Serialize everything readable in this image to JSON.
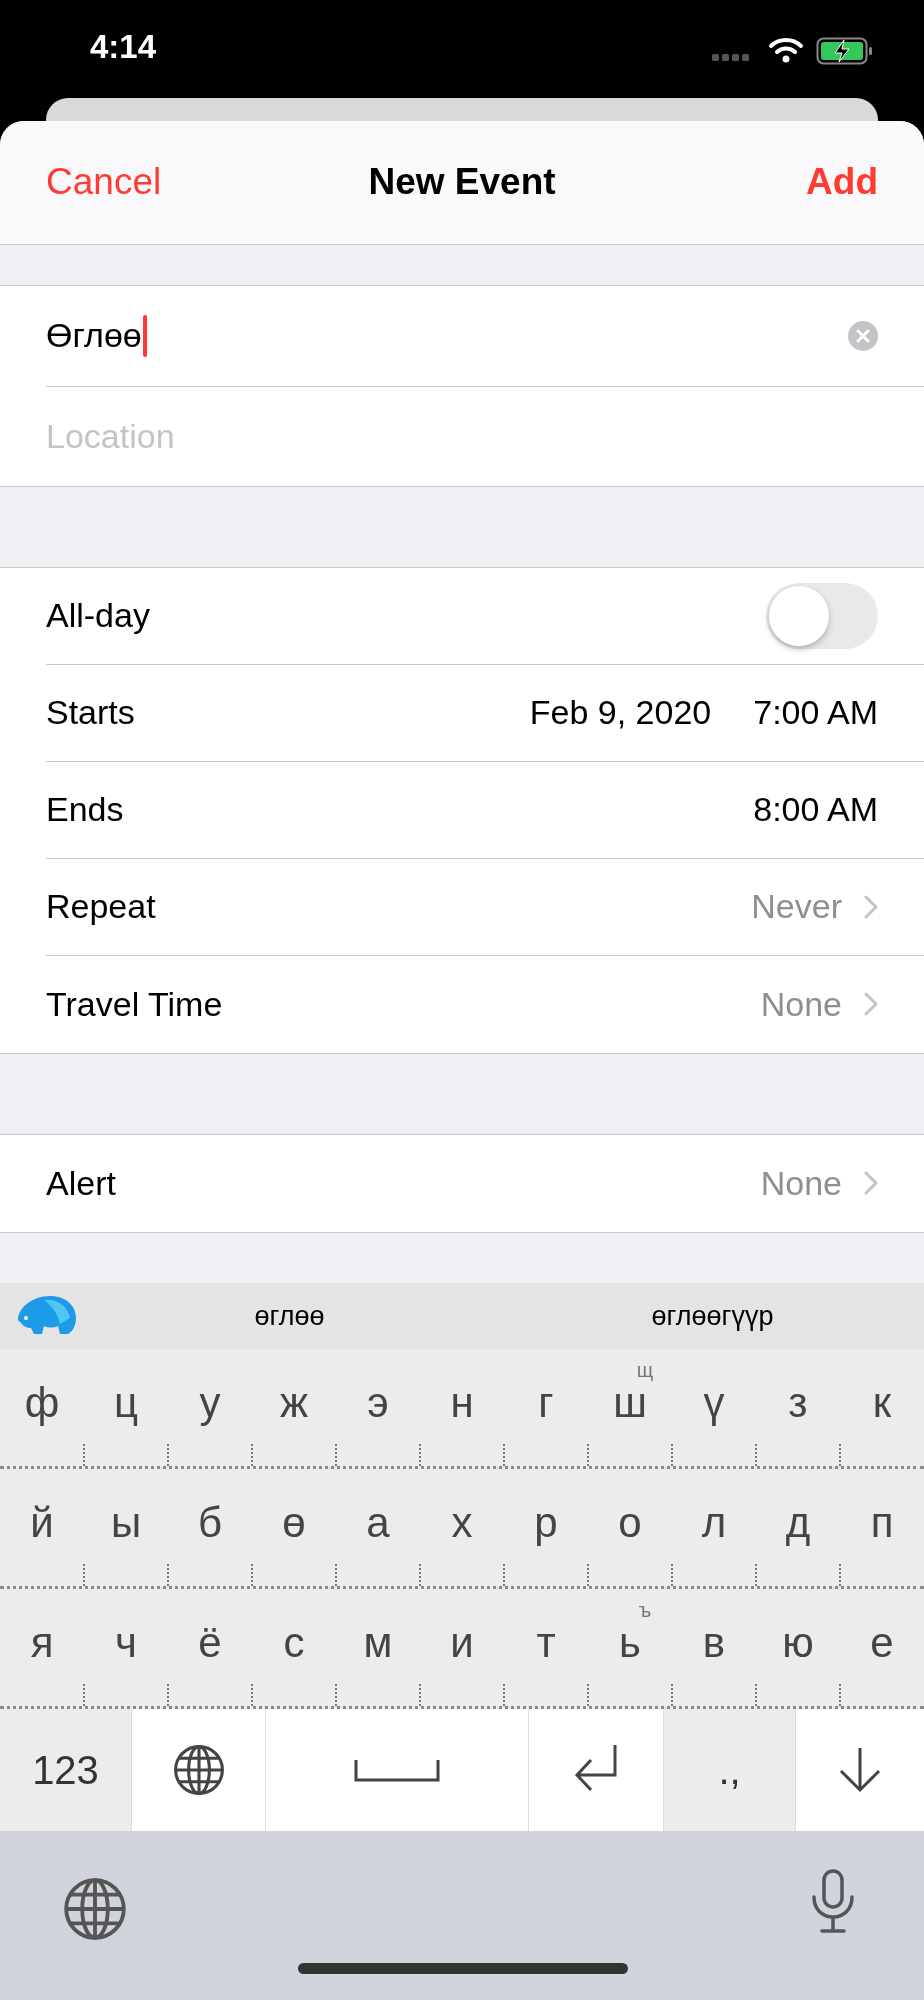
{
  "status_bar": {
    "time": "4:14"
  },
  "nav": {
    "cancel": "Cancel",
    "title": "New Event",
    "add": "Add"
  },
  "title_field": {
    "value": "Өглөө"
  },
  "location_field": {
    "placeholder": "Location"
  },
  "groups": [
    [
      {
        "kind": "toggle",
        "label": "All-day",
        "on": false
      },
      {
        "kind": "datetime",
        "label": "Starts",
        "date": "Feb 9, 2020",
        "time": "7:00 AM"
      },
      {
        "kind": "datetime",
        "label": "Ends",
        "time": "8:00 AM"
      },
      {
        "kind": "disclosure",
        "label": "Repeat",
        "value": "Never"
      },
      {
        "kind": "disclosure",
        "label": "Travel Time",
        "value": "None"
      }
    ],
    [
      {
        "kind": "disclosure",
        "label": "Alert",
        "value": "None"
      }
    ]
  ],
  "suggestions": [
    "өглөө",
    "өглөөгүүр"
  ],
  "keyboard": {
    "rows": [
      [
        {
          "key": "ф"
        },
        {
          "key": "ц"
        },
        {
          "key": "у"
        },
        {
          "key": "ж"
        },
        {
          "key": "э"
        },
        {
          "key": "н"
        },
        {
          "key": "г"
        },
        {
          "key": "ш",
          "hint": "щ"
        },
        {
          "key": "ү"
        },
        {
          "key": "з"
        },
        {
          "key": "к"
        }
      ],
      [
        {
          "key": "й"
        },
        {
          "key": "ы"
        },
        {
          "key": "б"
        },
        {
          "key": "ө"
        },
        {
          "key": "а"
        },
        {
          "key": "х"
        },
        {
          "key": "р"
        },
        {
          "key": "о"
        },
        {
          "key": "л"
        },
        {
          "key": "д"
        },
        {
          "key": "п"
        }
      ],
      [
        {
          "key": "я"
        },
        {
          "key": "ч"
        },
        {
          "key": "ё"
        },
        {
          "key": "с"
        },
        {
          "key": "м"
        },
        {
          "key": "и"
        },
        {
          "key": "т"
        },
        {
          "key": "ь",
          "hint": "ъ"
        },
        {
          "key": "в"
        },
        {
          "key": "ю"
        },
        {
          "key": "е"
        }
      ]
    ],
    "bottom": [
      {
        "kind": "text",
        "label": "123"
      },
      {
        "kind": "globe"
      },
      {
        "kind": "space"
      },
      {
        "kind": "return"
      },
      {
        "kind": "text",
        "label": ".,"
      },
      {
        "kind": "dismiss"
      }
    ]
  }
}
